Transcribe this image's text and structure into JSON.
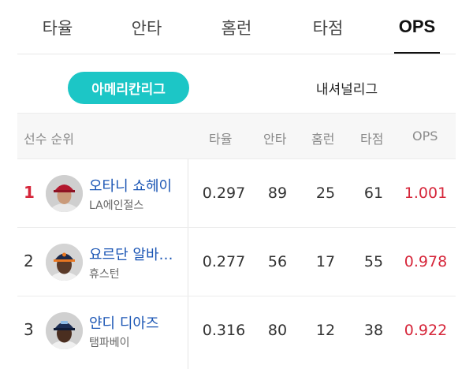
{
  "tabs": [
    {
      "label": "타율",
      "active": false
    },
    {
      "label": "안타",
      "active": false
    },
    {
      "label": "홈런",
      "active": false
    },
    {
      "label": "타점",
      "active": false
    },
    {
      "label": "OPS",
      "active": true
    }
  ],
  "league": {
    "selected": "아메리칸리그",
    "other": "내셔널리그",
    "accent_color": "#1cc6c6"
  },
  "table": {
    "headers": {
      "player": "선수 순위",
      "avg": "타율",
      "hits": "안타",
      "hr": "홈런",
      "rbi": "타점",
      "ops": "OPS"
    },
    "rows": [
      {
        "rank": "1",
        "name": "오타니 쇼헤이",
        "team": "LA에인절스",
        "avg": "0.297",
        "hits": "89",
        "hr": "25",
        "rbi": "61",
        "ops": "1.001"
      },
      {
        "rank": "2",
        "name": "요르단 알바레즈",
        "team": "휴스턴",
        "avg": "0.277",
        "hits": "56",
        "hr": "17",
        "rbi": "55",
        "ops": "0.978"
      },
      {
        "rank": "3",
        "name": "얀디 디아즈",
        "team": "탬파베이",
        "avg": "0.316",
        "hits": "80",
        "hr": "12",
        "rbi": "38",
        "ops": "0.922"
      }
    ]
  },
  "colors": {
    "highlight_red": "#d6263a",
    "name_blue": "#1a55b4"
  }
}
